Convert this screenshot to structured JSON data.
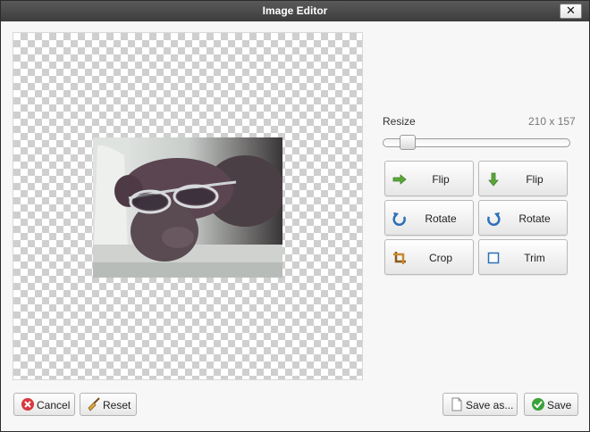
{
  "window": {
    "title": "Image Editor",
    "close_label": "✕"
  },
  "resize": {
    "label": "Resize",
    "dimensions": "210 x 157",
    "slider_level": 0.1
  },
  "tools": [
    {
      "label": "Flip",
      "icon": "arrow-right-icon"
    },
    {
      "label": "Flip",
      "icon": "arrow-down-icon"
    },
    {
      "label": "Rotate",
      "icon": "rotate-left-icon"
    },
    {
      "label": "Rotate",
      "icon": "rotate-right-icon"
    },
    {
      "label": "Crop",
      "icon": "crop-icon"
    },
    {
      "label": "Trim",
      "icon": "trim-icon"
    }
  ],
  "footer": {
    "cancel_label": "Cancel",
    "reset_label": "Reset",
    "save_as_label": "Save as...",
    "save_label": "Save"
  },
  "colors": {
    "titlebar": "#3c3c3c",
    "cancel_icon": "#d9363e",
    "save_icon": "#3aa23a",
    "flip_icon": "#4b9b2e",
    "rotate_icon": "#2d6fb8"
  }
}
